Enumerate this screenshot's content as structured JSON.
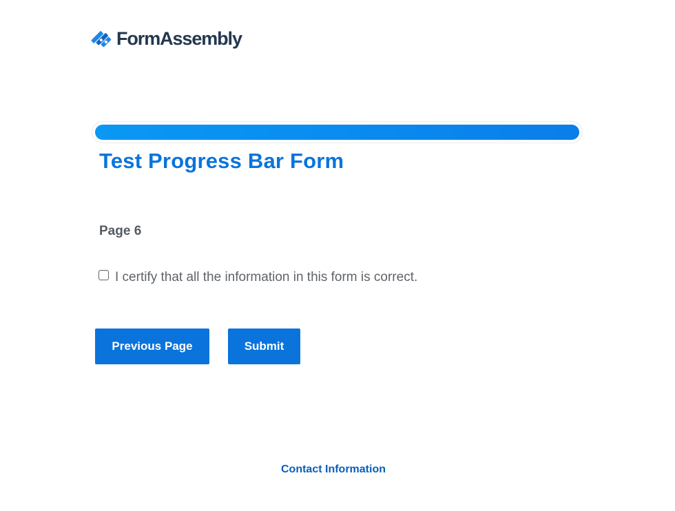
{
  "header": {
    "logo_text": "FormAssembly",
    "logo_icon": "formassembly-logo-icon",
    "brand_color": "#23374f"
  },
  "progress": {
    "value": 1.0,
    "fill_color": "#0a8cf0"
  },
  "form": {
    "title": "Test Progress Bar Form",
    "page_label": "Page 6",
    "certify_label": "I certify that all the information in this form is correct.",
    "certify_checked": false
  },
  "buttons": {
    "previous_label": "Previous Page",
    "submit_label": "Submit",
    "color": "#0a74dc"
  },
  "footer": {
    "contact_label": "Contact Information"
  }
}
